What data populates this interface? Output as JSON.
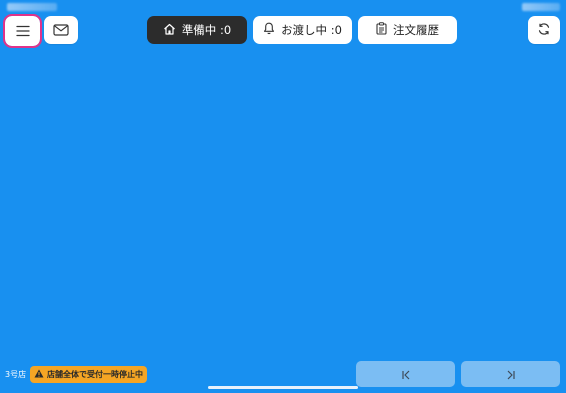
{
  "toolbar": {
    "menu_icon": "hamburger-menu-icon",
    "mail_icon": "envelope-icon",
    "refresh_icon": "refresh-icon"
  },
  "tabs": [
    {
      "label": "準備中 :0",
      "icon": "home-icon",
      "active": true
    },
    {
      "label": "お渡し中 :0",
      "icon": "bell-icon",
      "active": false
    },
    {
      "label": "注文履歴",
      "icon": "clipboard-icon",
      "active": false
    }
  ],
  "footer": {
    "store_name": "3号店",
    "pause_notice": "店舗全体で受付一時停止中",
    "pause_icon": "warning-icon"
  },
  "pagination": {
    "first_icon": "skip-to-first-icon",
    "last_icon": "skip-to-last-icon"
  },
  "colors": {
    "background": "#1890f0",
    "active_tab": "#2c2c2c",
    "pause_badge": "#f5a524",
    "nav_button": "#7bbdf3",
    "focus_outline": "#e0338a"
  }
}
